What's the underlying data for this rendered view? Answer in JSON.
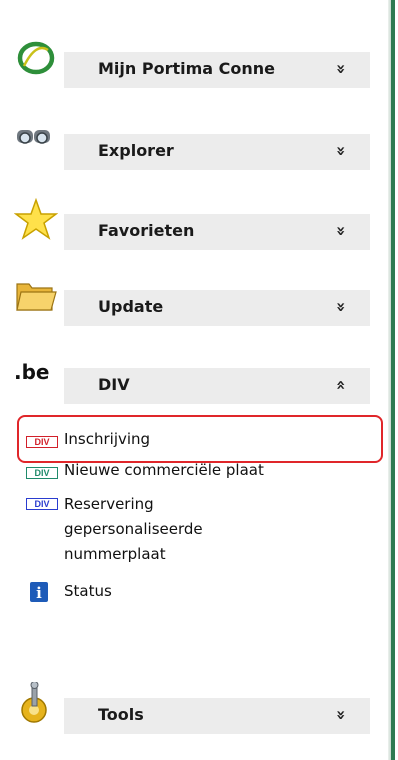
{
  "groups": [
    {
      "id": "portima",
      "title": "Mijn Portima Conne",
      "expanded": false,
      "icon": "portima-logo-icon"
    },
    {
      "id": "explorer",
      "title": "Explorer",
      "expanded": false,
      "icon": "binoculars-icon"
    },
    {
      "id": "favorieten",
      "title": "Favorieten",
      "expanded": false,
      "icon": "star-icon"
    },
    {
      "id": "update",
      "title": "Update",
      "expanded": false,
      "icon": "folder-icon"
    },
    {
      "id": "div",
      "title": "DIV",
      "expanded": true,
      "icon": "be-domain-icon",
      "icon_text": ".be"
    },
    {
      "id": "tools",
      "title": "Tools",
      "expanded": false,
      "icon": "tools-gear-icon"
    }
  ],
  "div_items": [
    {
      "label": "Inschrijving",
      "icon": "div-badge-icon",
      "icon_text": "DIV",
      "icon_color": "#d2202a",
      "highlighted": true
    },
    {
      "label": "Nieuwe commerciële plaat",
      "icon": "div-badge-icon",
      "icon_text": "DIV",
      "icon_color": "#1f8a6b"
    },
    {
      "label": "Reservering gepersonaliseerde nummerplaat",
      "icon": "div-badge-icon",
      "icon_text": "DIV",
      "icon_color": "#2a3ccf"
    },
    {
      "label": "Status",
      "icon": "info-icon",
      "icon_text": "i",
      "icon_color": "#1e5bb8"
    }
  ],
  "chevrons": {
    "collapsed": "»",
    "expanded": "«"
  },
  "colors": {
    "rail": "#2f7a52",
    "highlight": "#e0262a",
    "group_bar": "#ececec"
  }
}
